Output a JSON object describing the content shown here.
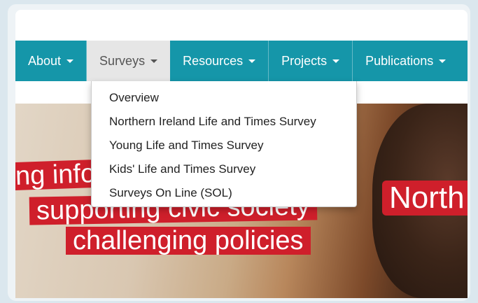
{
  "nav": {
    "items": [
      {
        "label": "About"
      },
      {
        "label": "Surveys"
      },
      {
        "label": "Resources"
      },
      {
        "label": "Projects"
      },
      {
        "label": "Publications"
      }
    ],
    "active": "Surveys"
  },
  "dropdown": {
    "items": [
      {
        "label": "Overview"
      },
      {
        "label": "Northern Ireland Life and Times Survey"
      },
      {
        "label": "Young Life and Times Survey"
      },
      {
        "label": "Kids' Life and Times Survey"
      },
      {
        "label": "Surveys On Line (SOL)"
      }
    ]
  },
  "hero": {
    "line1": "ng info",
    "line2": "supporting civic society",
    "line3": "challenging policies",
    "right": "North"
  },
  "colors": {
    "nav_bg": "#1596a9",
    "active_bg": "#e6e6e6",
    "banner_red": "#cf1f2b"
  }
}
